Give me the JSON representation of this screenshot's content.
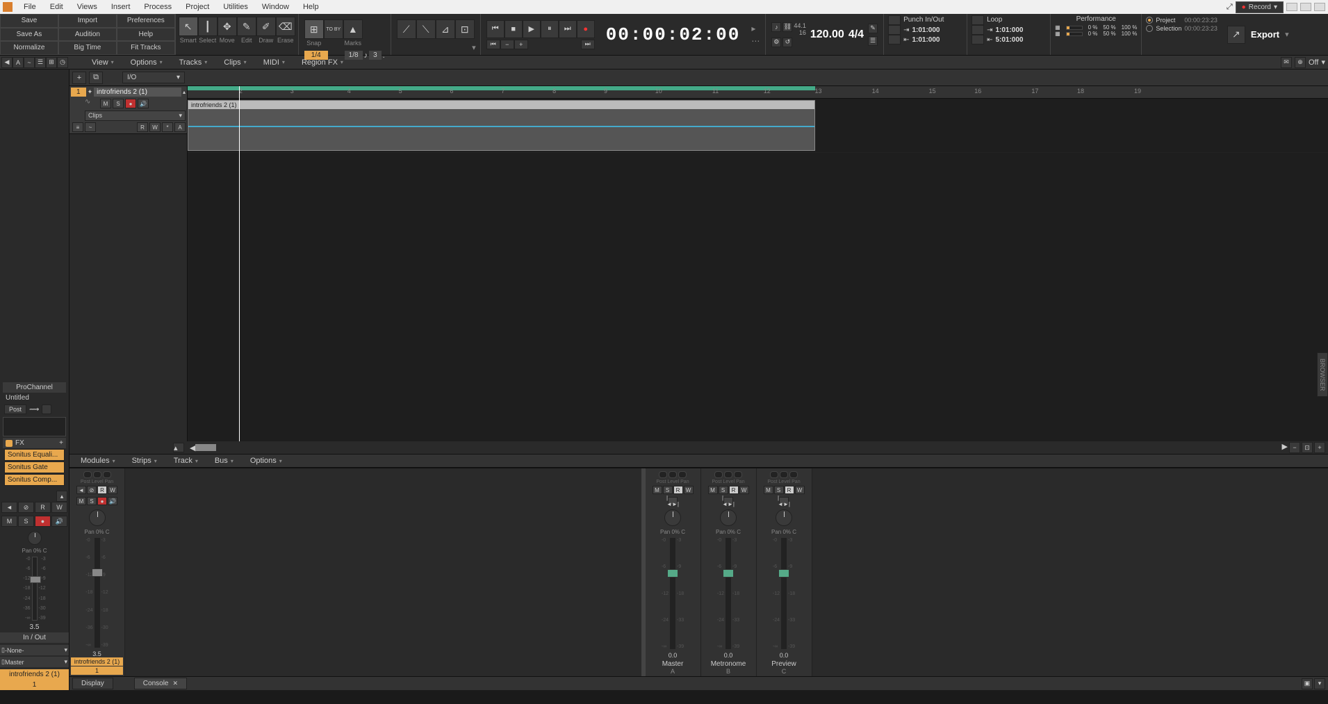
{
  "menubar": {
    "items": [
      "File",
      "Edit",
      "Views",
      "Insert",
      "Process",
      "Project",
      "Utilities",
      "Window",
      "Help"
    ],
    "record_label": "Record"
  },
  "toolbar": {
    "file_buttons": [
      "Save",
      "Import",
      "Preferences",
      "Save As",
      "Audition",
      "Help",
      "Normalize",
      "Big Time",
      "Fit Tracks"
    ],
    "tools": [
      "Smart",
      "Select",
      "Move",
      "Edit",
      "Draw",
      "Erase"
    ],
    "snap_label": "Snap",
    "toby_label": "TO BY",
    "marks_label": "Marks",
    "snap_val1": "1/4",
    "snap_val2": "1/8",
    "snap_val3": "3"
  },
  "transport": {
    "time": "00:00:02:00",
    "sample_rate": "44.1",
    "bit_depth": "16",
    "tempo": "120.00",
    "time_sig": "4/4"
  },
  "punch": {
    "title": "Punch In/Out",
    "in": "1:01:000",
    "out": "1:01:000"
  },
  "loop": {
    "title": "Loop",
    "in": "1:01:000",
    "out": "5:01:000"
  },
  "performance": {
    "title": "Performance",
    "cpu1": "0 %",
    "cpu2": "50 %",
    "cpu3": "100 %",
    "mem1": "0 %",
    "mem2": "50 %",
    "mem3": "100 %"
  },
  "export": {
    "label": "Export"
  },
  "radios": {
    "project": "Project",
    "project_time": "00:00:23:23",
    "selection": "Selection",
    "selection_time": "00:00:23:23"
  },
  "secondary": {
    "menus": [
      "View",
      "Options",
      "Tracks",
      "Clips",
      "MIDI",
      "Region FX"
    ],
    "off_label": "Off"
  },
  "track_header": {
    "io": "I/O"
  },
  "ruler": {
    "marks": [
      2,
      3,
      4,
      5,
      6,
      7,
      8,
      9,
      10,
      11,
      12,
      13,
      14,
      15,
      16,
      17,
      18,
      19
    ]
  },
  "track": {
    "num": "1",
    "name": "introfriends 2 (1)",
    "clips_label": "Clips",
    "buttons": {
      "m": "M",
      "s": "S",
      "r": "R",
      "w": "W",
      "star": "*",
      "a": "A"
    }
  },
  "clip": {
    "name": "introfriends 2 (1)"
  },
  "prochannel": {
    "title": "ProChannel",
    "untitled": "Untitled",
    "post": "Post",
    "fx_title": "FX",
    "fx_items": [
      "Sonitus Equali...",
      "Sonitus Gate",
      "Sonitus Comp..."
    ]
  },
  "inspector": {
    "buttons1": [
      "◄",
      "⊘",
      "R",
      "W"
    ],
    "buttons2": [
      "M",
      "S",
      "●",
      "🔊"
    ],
    "pan": "Pan",
    "pan_val": "0% C",
    "gain": "3.5",
    "in_out": "In / Out",
    "in": "-None-",
    "out": "Master",
    "track_name": "introfriends 2 (1)",
    "track_num": "1",
    "scale": [
      "-0",
      "-6",
      "-12",
      "-18",
      "-24",
      "-36",
      "-∞"
    ]
  },
  "console_bar": {
    "menus": [
      "Modules",
      "Strips",
      "Track",
      "Bus",
      "Options"
    ]
  },
  "mixer": {
    "track_strip": {
      "buttons1": [
        "◄",
        "⊘",
        "R",
        "W"
      ],
      "buttons2": [
        "M",
        "S",
        "●",
        "🔊"
      ],
      "pan": "Pan",
      "pan_val": "0% C",
      "gain": "3.5",
      "name": "introfriends 2 (1)",
      "num": "1"
    },
    "bus_strips": [
      {
        "pan": "Pan",
        "pan_val": "0% C",
        "gain": "0.0",
        "name": "Master",
        "ch": "A"
      },
      {
        "pan": "Pan",
        "pan_val": "0% C",
        "gain": "0.0",
        "name": "Metronome",
        "ch": "B"
      },
      {
        "pan": "Pan",
        "pan_val": "0% C",
        "gain": "0.0",
        "name": "Preview",
        "ch": "C"
      }
    ],
    "bus_buttons": [
      "M",
      "S",
      "R",
      "W"
    ],
    "scale": [
      "-3",
      "-6",
      "-9",
      "-12",
      "-18",
      "-24",
      "-36",
      "-∞"
    ],
    "labels": [
      "Post",
      "Level",
      "Pan"
    ]
  },
  "bottom": {
    "display": "Display",
    "console": "Console"
  },
  "browser": "BROWSER"
}
